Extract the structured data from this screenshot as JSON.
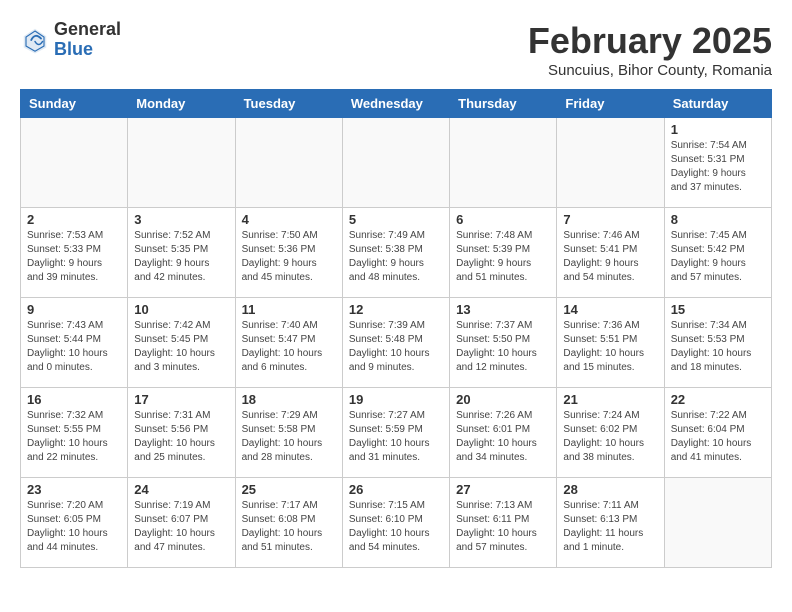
{
  "logo": {
    "general": "General",
    "blue": "Blue"
  },
  "header": {
    "month": "February 2025",
    "location": "Suncuius, Bihor County, Romania"
  },
  "weekdays": [
    "Sunday",
    "Monday",
    "Tuesday",
    "Wednesday",
    "Thursday",
    "Friday",
    "Saturday"
  ],
  "weeks": [
    [
      {
        "day": "",
        "info": ""
      },
      {
        "day": "",
        "info": ""
      },
      {
        "day": "",
        "info": ""
      },
      {
        "day": "",
        "info": ""
      },
      {
        "day": "",
        "info": ""
      },
      {
        "day": "",
        "info": ""
      },
      {
        "day": "1",
        "info": "Sunrise: 7:54 AM\nSunset: 5:31 PM\nDaylight: 9 hours and 37 minutes."
      }
    ],
    [
      {
        "day": "2",
        "info": "Sunrise: 7:53 AM\nSunset: 5:33 PM\nDaylight: 9 hours and 39 minutes."
      },
      {
        "day": "3",
        "info": "Sunrise: 7:52 AM\nSunset: 5:35 PM\nDaylight: 9 hours and 42 minutes."
      },
      {
        "day": "4",
        "info": "Sunrise: 7:50 AM\nSunset: 5:36 PM\nDaylight: 9 hours and 45 minutes."
      },
      {
        "day": "5",
        "info": "Sunrise: 7:49 AM\nSunset: 5:38 PM\nDaylight: 9 hours and 48 minutes."
      },
      {
        "day": "6",
        "info": "Sunrise: 7:48 AM\nSunset: 5:39 PM\nDaylight: 9 hours and 51 minutes."
      },
      {
        "day": "7",
        "info": "Sunrise: 7:46 AM\nSunset: 5:41 PM\nDaylight: 9 hours and 54 minutes."
      },
      {
        "day": "8",
        "info": "Sunrise: 7:45 AM\nSunset: 5:42 PM\nDaylight: 9 hours and 57 minutes."
      }
    ],
    [
      {
        "day": "9",
        "info": "Sunrise: 7:43 AM\nSunset: 5:44 PM\nDaylight: 10 hours and 0 minutes."
      },
      {
        "day": "10",
        "info": "Sunrise: 7:42 AM\nSunset: 5:45 PM\nDaylight: 10 hours and 3 minutes."
      },
      {
        "day": "11",
        "info": "Sunrise: 7:40 AM\nSunset: 5:47 PM\nDaylight: 10 hours and 6 minutes."
      },
      {
        "day": "12",
        "info": "Sunrise: 7:39 AM\nSunset: 5:48 PM\nDaylight: 10 hours and 9 minutes."
      },
      {
        "day": "13",
        "info": "Sunrise: 7:37 AM\nSunset: 5:50 PM\nDaylight: 10 hours and 12 minutes."
      },
      {
        "day": "14",
        "info": "Sunrise: 7:36 AM\nSunset: 5:51 PM\nDaylight: 10 hours and 15 minutes."
      },
      {
        "day": "15",
        "info": "Sunrise: 7:34 AM\nSunset: 5:53 PM\nDaylight: 10 hours and 18 minutes."
      }
    ],
    [
      {
        "day": "16",
        "info": "Sunrise: 7:32 AM\nSunset: 5:55 PM\nDaylight: 10 hours and 22 minutes."
      },
      {
        "day": "17",
        "info": "Sunrise: 7:31 AM\nSunset: 5:56 PM\nDaylight: 10 hours and 25 minutes."
      },
      {
        "day": "18",
        "info": "Sunrise: 7:29 AM\nSunset: 5:58 PM\nDaylight: 10 hours and 28 minutes."
      },
      {
        "day": "19",
        "info": "Sunrise: 7:27 AM\nSunset: 5:59 PM\nDaylight: 10 hours and 31 minutes."
      },
      {
        "day": "20",
        "info": "Sunrise: 7:26 AM\nSunset: 6:01 PM\nDaylight: 10 hours and 34 minutes."
      },
      {
        "day": "21",
        "info": "Sunrise: 7:24 AM\nSunset: 6:02 PM\nDaylight: 10 hours and 38 minutes."
      },
      {
        "day": "22",
        "info": "Sunrise: 7:22 AM\nSunset: 6:04 PM\nDaylight: 10 hours and 41 minutes."
      }
    ],
    [
      {
        "day": "23",
        "info": "Sunrise: 7:20 AM\nSunset: 6:05 PM\nDaylight: 10 hours and 44 minutes."
      },
      {
        "day": "24",
        "info": "Sunrise: 7:19 AM\nSunset: 6:07 PM\nDaylight: 10 hours and 47 minutes."
      },
      {
        "day": "25",
        "info": "Sunrise: 7:17 AM\nSunset: 6:08 PM\nDaylight: 10 hours and 51 minutes."
      },
      {
        "day": "26",
        "info": "Sunrise: 7:15 AM\nSunset: 6:10 PM\nDaylight: 10 hours and 54 minutes."
      },
      {
        "day": "27",
        "info": "Sunrise: 7:13 AM\nSunset: 6:11 PM\nDaylight: 10 hours and 57 minutes."
      },
      {
        "day": "28",
        "info": "Sunrise: 7:11 AM\nSunset: 6:13 PM\nDaylight: 11 hours and 1 minute."
      },
      {
        "day": "",
        "info": ""
      }
    ]
  ]
}
